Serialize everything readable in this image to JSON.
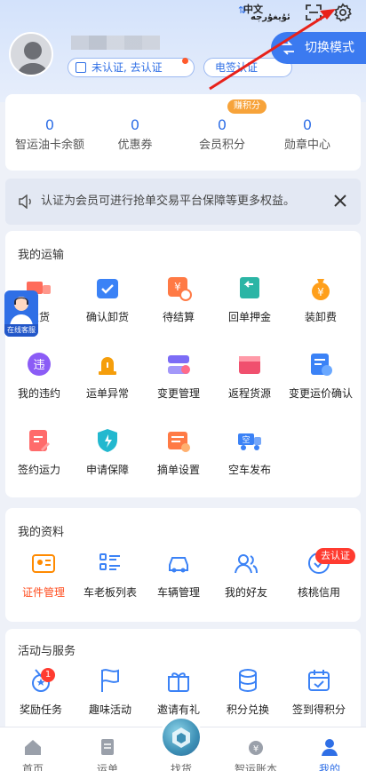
{
  "header": {
    "lang_zh": "中文",
    "lang_ug": "ئۇيغۇرچە",
    "certify_label": "未认证, 去认证",
    "esign_label": "电签认证",
    "switch_mode_label": "切换模式"
  },
  "stats": {
    "earn_tag": "赚积分",
    "items": [
      {
        "value": "0",
        "label": "智运油卡余额"
      },
      {
        "value": "0",
        "label": "优惠券"
      },
      {
        "value": "0",
        "label": "会员积分"
      },
      {
        "value": "0",
        "label": "勋章中心"
      }
    ]
  },
  "notice": {
    "text": "认证为会员可进行抢单交易平台保障等更多权益。"
  },
  "transport": {
    "title": "我的运输",
    "items": [
      {
        "label": "发货",
        "icon": "truck-icon",
        "color": "#ff6b5a"
      },
      {
        "label": "确认卸货",
        "icon": "unload-box-icon",
        "color": "#3b82f6"
      },
      {
        "label": "待结算",
        "icon": "settle-clock-icon",
        "color": "#ff7a45"
      },
      {
        "label": "回单押金",
        "icon": "receipt-return-icon",
        "color": "#2bb5a5"
      },
      {
        "label": "装卸费",
        "icon": "money-bag-icon",
        "color": "#ff9f1a"
      },
      {
        "label": "我的违约",
        "icon": "violation-icon",
        "color": "#8b5cf6"
      },
      {
        "label": "运单异常",
        "icon": "alarm-light-icon",
        "color": "#f59e0b"
      },
      {
        "label": "变更管理",
        "icon": "change-manage-icon",
        "color": "#7c6cf6"
      },
      {
        "label": "返程货源",
        "icon": "return-cargo-icon",
        "color": "#f0506e"
      },
      {
        "label": "变更运价确认",
        "icon": "price-change-icon",
        "color": "#3b82f6"
      },
      {
        "label": "签约运力",
        "icon": "sign-contract-icon",
        "color": "#ff6b6b"
      },
      {
        "label": "申请保障",
        "icon": "shield-icon",
        "color": "#22b8cf"
      },
      {
        "label": "摘单设置",
        "icon": "order-setting-icon",
        "color": "#ff7a45"
      },
      {
        "label": "空车发布",
        "icon": "empty-truck-icon",
        "color": "#3b82f6"
      }
    ],
    "customer_service": "在线客服"
  },
  "profile": {
    "title": "我的资料",
    "go_certify_tag": "去认证",
    "items": [
      {
        "label": "证件管理",
        "icon": "id-card-icon"
      },
      {
        "label": "车老板列表",
        "icon": "list-icon"
      },
      {
        "label": "车辆管理",
        "icon": "car-icon"
      },
      {
        "label": "我的好友",
        "icon": "friends-icon"
      },
      {
        "label": "核桃信用",
        "icon": "credit-icon"
      }
    ]
  },
  "activities": {
    "title": "活动与服务",
    "reward_badge": "1",
    "items": [
      {
        "label": "奖励任务",
        "icon": "medal-icon"
      },
      {
        "label": "趣味活动",
        "icon": "flag-icon"
      },
      {
        "label": "邀请有礼",
        "icon": "gift-icon"
      },
      {
        "label": "积分兑换",
        "icon": "coins-icon"
      },
      {
        "label": "签到得积分",
        "icon": "calendar-check-icon"
      }
    ]
  },
  "tabbar": {
    "items": [
      {
        "label": "首页",
        "icon": "home-icon"
      },
      {
        "label": "运单",
        "icon": "waybill-icon"
      },
      {
        "label": "找货",
        "icon": "find-cargo-icon"
      },
      {
        "label": "智运账本",
        "icon": "ledger-icon"
      },
      {
        "label": "我的",
        "icon": "user-icon"
      }
    ]
  },
  "colors": {
    "accent": "#2f6fe6",
    "annotation_arrow": "#e8211a"
  }
}
